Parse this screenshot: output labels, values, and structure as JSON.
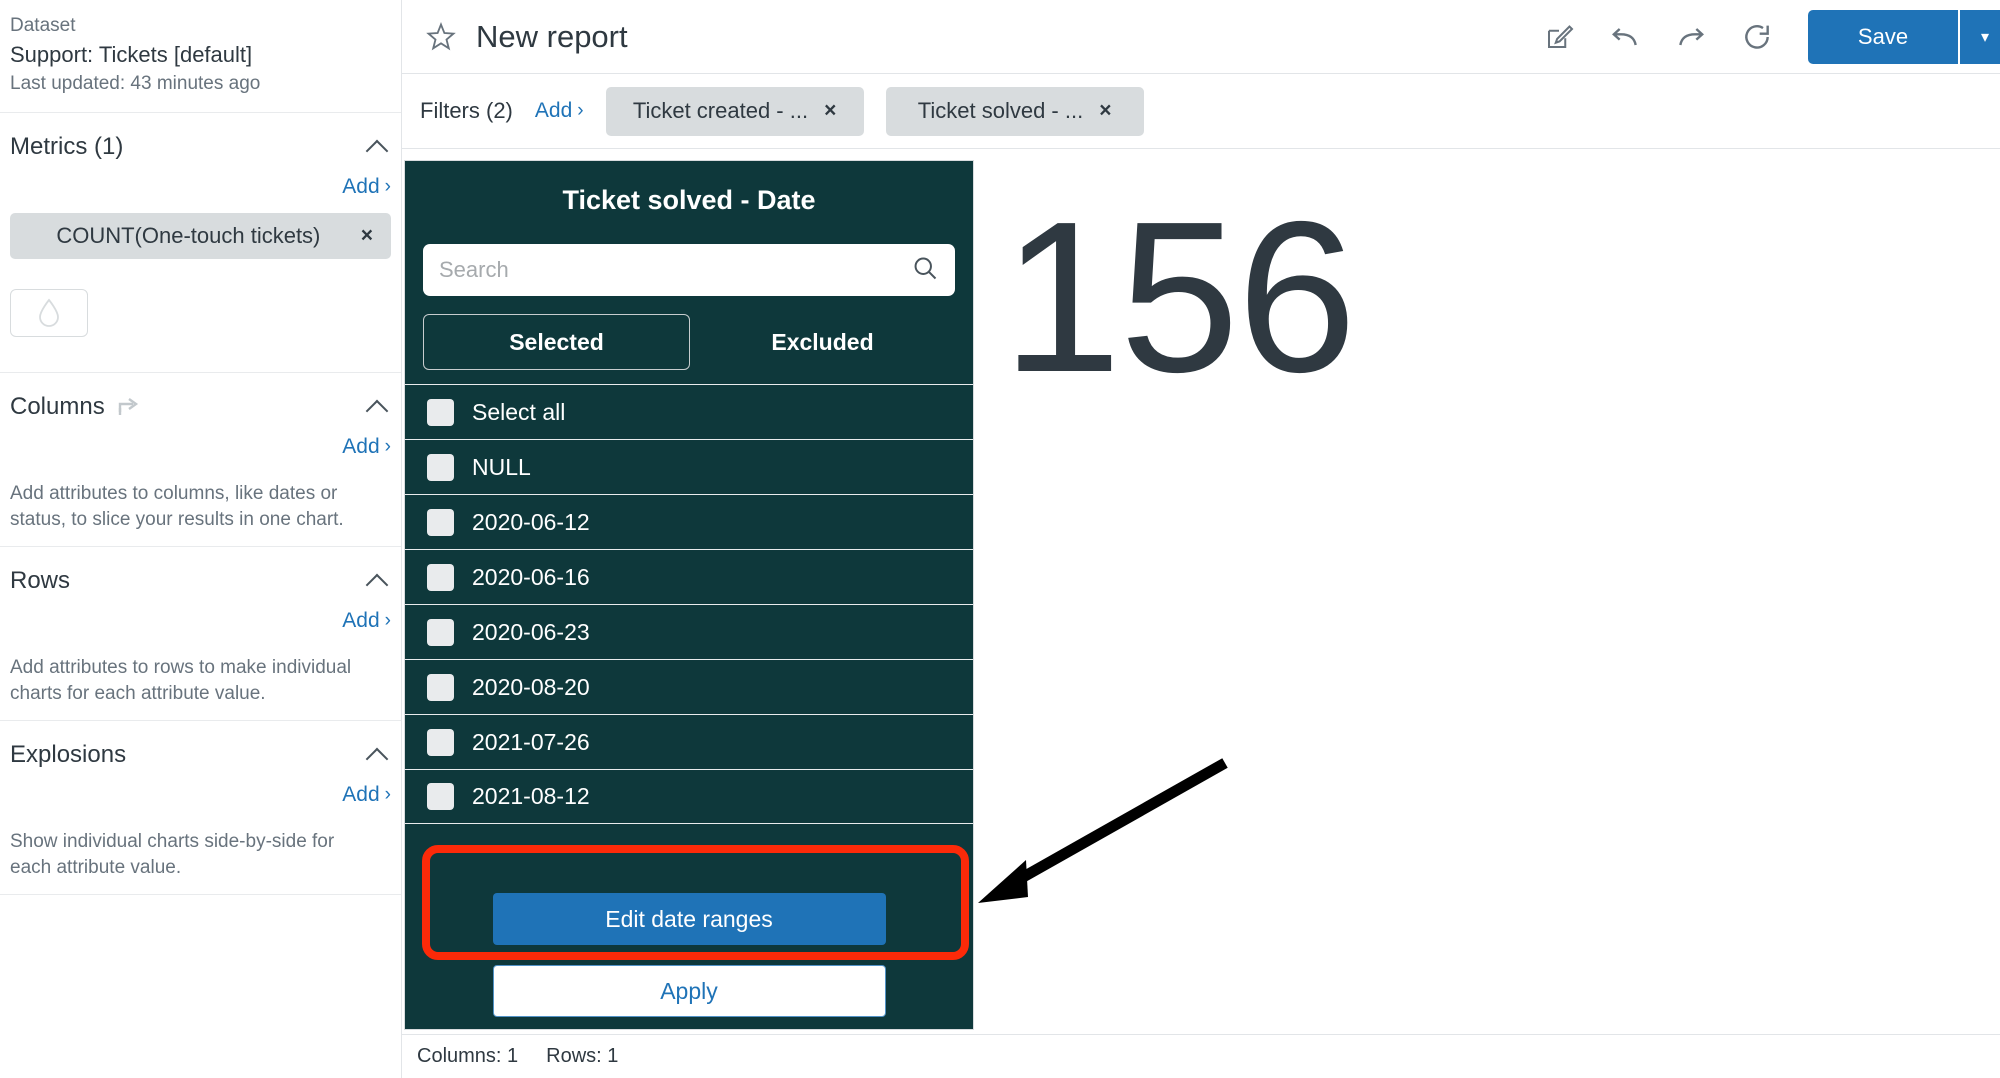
{
  "sidebar": {
    "dataset": {
      "label": "Dataset",
      "name": "Support: Tickets [default]",
      "updated": "Last updated: 43 minutes ago"
    },
    "metrics": {
      "title": "Metrics (1)",
      "add_label": "Add",
      "add_caret": "›",
      "chips": [
        {
          "label": "COUNT(One-touch tickets)",
          "remove": "×"
        }
      ]
    },
    "columns": {
      "title": "Columns",
      "add_label": "Add",
      "add_caret": "›",
      "hint": "Add attributes to columns, like dates or status, to slice your results in one chart."
    },
    "rows": {
      "title": "Rows",
      "add_label": "Add",
      "add_caret": "›",
      "hint": "Add attributes to rows to make individual charts for each attribute value."
    },
    "explosions": {
      "title": "Explosions",
      "add_label": "Add",
      "add_caret": "›",
      "hint": "Show individual charts side-by-side for each attribute value."
    }
  },
  "topbar": {
    "title": "New report",
    "save_label": "Save",
    "save_split_caret": "▾"
  },
  "filterbar": {
    "label": "Filters (2)",
    "add_label": "Add",
    "add_caret": "›",
    "chips": [
      {
        "label": "Ticket created - ...",
        "remove": "×"
      },
      {
        "label": "Ticket solved - ...",
        "remove": "×"
      }
    ]
  },
  "canvas": {
    "big_number": "156"
  },
  "statusbar": {
    "columns": "Columns: 1",
    "rows": "Rows: 1"
  },
  "filter_panel": {
    "title": "Ticket solved - Date",
    "search_placeholder": "Search",
    "search_value": "",
    "tabs": [
      {
        "label": "Selected",
        "active": true
      },
      {
        "label": "Excluded",
        "active": false
      }
    ],
    "rows": [
      {
        "label": "Select all",
        "checked": false
      },
      {
        "label": "NULL",
        "checked": false
      },
      {
        "label": "2020-06-12",
        "checked": false
      },
      {
        "label": "2020-06-16",
        "checked": false
      },
      {
        "label": "2020-06-23",
        "checked": false
      },
      {
        "label": "2020-08-20",
        "checked": false
      },
      {
        "label": "2021-07-26",
        "checked": false
      },
      {
        "label": "2021-08-12",
        "checked": false
      }
    ],
    "edit_ranges_label": "Edit date ranges",
    "apply_label": "Apply"
  },
  "annotations": {
    "highlight_color": "#fc2a09",
    "arrow_color": "#000000"
  },
  "colors": {
    "accent_blue": "#1f73b7",
    "panel_teal": "#0e383b",
    "chip_gray": "#d8dcde",
    "text_dark": "#2f3941"
  }
}
